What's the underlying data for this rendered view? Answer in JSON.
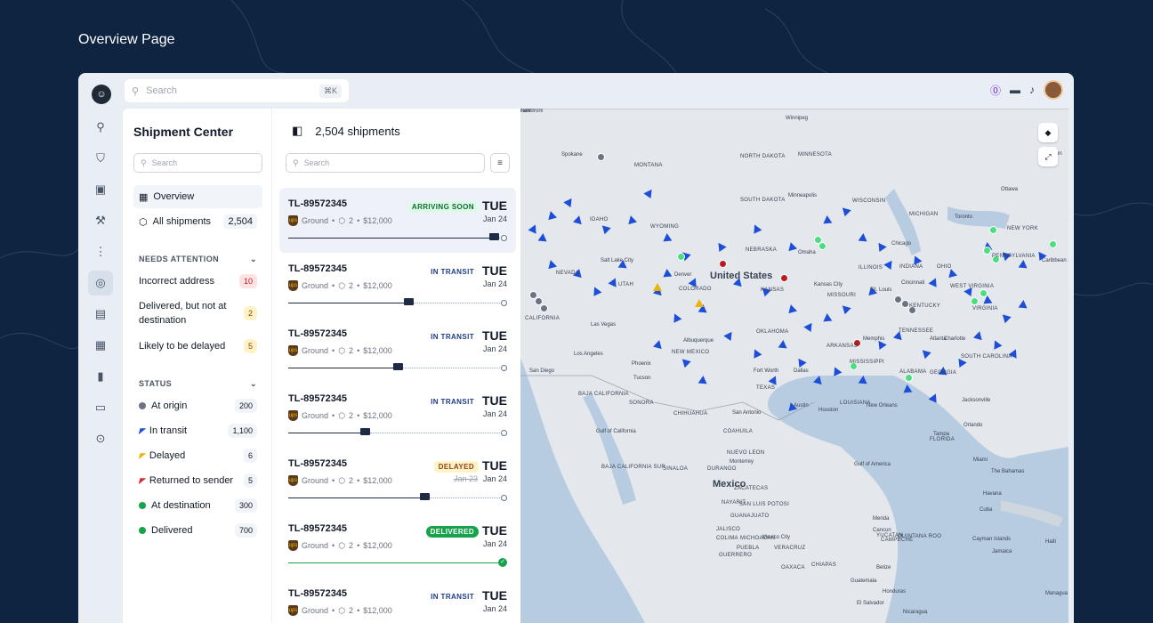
{
  "page_label": "Overview Page",
  "topbar": {
    "search_placeholder": "Search",
    "search_shortcut": "⌘K"
  },
  "left_panel": {
    "title": "Shipment Center",
    "search_placeholder": "Search",
    "nav": [
      {
        "label": "Overview",
        "count": ""
      },
      {
        "label": "All shipments",
        "count": "2,504"
      }
    ],
    "needs_attention": {
      "heading": "NEEDS ATTENTION",
      "items": [
        {
          "label": "Incorrect address",
          "count": "10"
        },
        {
          "label": "Delivered, but not at destination",
          "count": "2"
        },
        {
          "label": "Likely to be delayed",
          "count": "5"
        }
      ]
    },
    "status": {
      "heading": "STATUS",
      "items": [
        {
          "label": "At origin",
          "count": "200",
          "color": "#6b7280"
        },
        {
          "label": "In transit",
          "count": "1,100",
          "color": "#1d4ed8"
        },
        {
          "label": "Delayed",
          "count": "6",
          "color": "#eab308"
        },
        {
          "label": "Returned to sender",
          "count": "5",
          "color": "#dc2626"
        },
        {
          "label": "At destination",
          "count": "300",
          "color": "#16a34a"
        },
        {
          "label": "Delivered",
          "count": "700",
          "color": "#16a34a"
        }
      ]
    }
  },
  "shipments": {
    "header": "2,504 shipments",
    "search_placeholder": "Search",
    "cards": [
      {
        "id": "TL-89572345",
        "carrier": "Ground",
        "pkgs": "2",
        "price": "$12,000",
        "status": "ARRIVING SOON",
        "day": "TUE",
        "date": "Jan 24",
        "old_date": "",
        "progress": 0.92
      },
      {
        "id": "TL-89572345",
        "carrier": "Ground",
        "pkgs": "2",
        "price": "$12,000",
        "status": "IN TRANSIT",
        "day": "TUE",
        "date": "Jan 24",
        "old_date": "",
        "progress": 0.53
      },
      {
        "id": "TL-89572345",
        "carrier": "Ground",
        "pkgs": "2",
        "price": "$12,000",
        "status": "IN TRANSIT",
        "day": "TUE",
        "date": "Jan 24",
        "old_date": "",
        "progress": 0.48
      },
      {
        "id": "TL-89572345",
        "carrier": "Ground",
        "pkgs": "2",
        "price": "$12,000",
        "status": "IN TRANSIT",
        "day": "TUE",
        "date": "Jan 24",
        "old_date": "",
        "progress": 0.33
      },
      {
        "id": "TL-89572345",
        "carrier": "Ground",
        "pkgs": "2",
        "price": "$12,000",
        "status": "DELAYED",
        "day": "TUE",
        "date": "Jan 24",
        "old_date": "Jan 23",
        "progress": 0.6
      },
      {
        "id": "TL-89572345",
        "carrier": "Ground",
        "pkgs": "2",
        "price": "$12,000",
        "status": "DELIVERED",
        "day": "TUE",
        "date": "Jan 24",
        "old_date": "",
        "progress": 1.0
      },
      {
        "id": "TL-89572345",
        "carrier": "Ground",
        "pkgs": "2",
        "price": "$12,000",
        "status": "IN TRANSIT",
        "day": "TUE",
        "date": "Jan 24",
        "old_date": "",
        "progress": 0.4
      }
    ]
  },
  "map": {
    "labels": [
      "Winnipeg",
      "Spokane",
      "MONTANA",
      "NORTH DAKOTA",
      "MINNESOTA",
      "Ottawa",
      "SOUTH DAKOTA",
      "Minneapolis",
      "WISCONSIN",
      "IDAHO",
      "WYOMING",
      "MICHIGAN",
      "Toronto",
      "NEW YORK",
      "Chicago",
      "NEBRASKA",
      "Omaha",
      "PENNSYLVANIA",
      "Salt Lake City",
      "Denver",
      "United States",
      "ILLINOIS",
      "INDIANA",
      "OHIO",
      "NEVADA",
      "UTAH",
      "COLORADO",
      "KANSAS",
      "Kansas City",
      "St. Louis",
      "Cincinnati",
      "WEST VIRGINIA",
      "MISSOURI",
      "KENTUCKY",
      "VIRGINIA",
      "CALIFORNIA",
      "Las Vegas",
      "OKLAHOMA",
      "TENNESSEE",
      "Charlotte",
      "Los Angeles",
      "Albuquerque",
      "ARKANSAS",
      "Memphis",
      "Atlanta",
      "Phoenix",
      "NEW MEXICO",
      "MISSISSIPPI",
      "SOUTH CAROLINA",
      "San Diego",
      "Tucson",
      "Fort Worth",
      "Dallas",
      "ALABAMA",
      "GEORGIA",
      "TEXAS",
      "LOUISIANA",
      "BAJA CALIFORNIA",
      "SONORA",
      "CHIHUAHUA",
      "San Antonio",
      "Austin",
      "Houston",
      "New Orleans",
      "Jacksonville",
      "Orlando",
      "Tampa",
      "FLORIDA",
      "COAHUILA",
      "Gulf of California",
      "Miami",
      "Monterrey",
      "NUEVO LEON",
      "BAJA CALIFORNIA SUR",
      "SINALOA",
      "DURANGO",
      "Gulf of America",
      "The Bahamas",
      "Mexico",
      "ZACATECAS",
      "SAN LUIS POTOSI",
      "Havana",
      "Cuba",
      "NAYARIT",
      "GUANAJUATO",
      "JALISCO",
      "Merida",
      "Cancun",
      "COLIMA",
      "MICHOACAN",
      "Mexico City",
      "CAMPECHE",
      "YUCATAN",
      "QUINTANA ROO",
      "Cayman Islands",
      "Haiti",
      "Jamaica",
      "PUEBLA",
      "VERACRUZ",
      "GUERRERO",
      "OAXACA",
      "CHIAPAS",
      "Belize",
      "Guatemala",
      "Honduras",
      "El Salvador",
      "Nicaragua",
      "Managua",
      "Caribbean Sea",
      "Boston",
      "New York",
      "Turks"
    ]
  }
}
